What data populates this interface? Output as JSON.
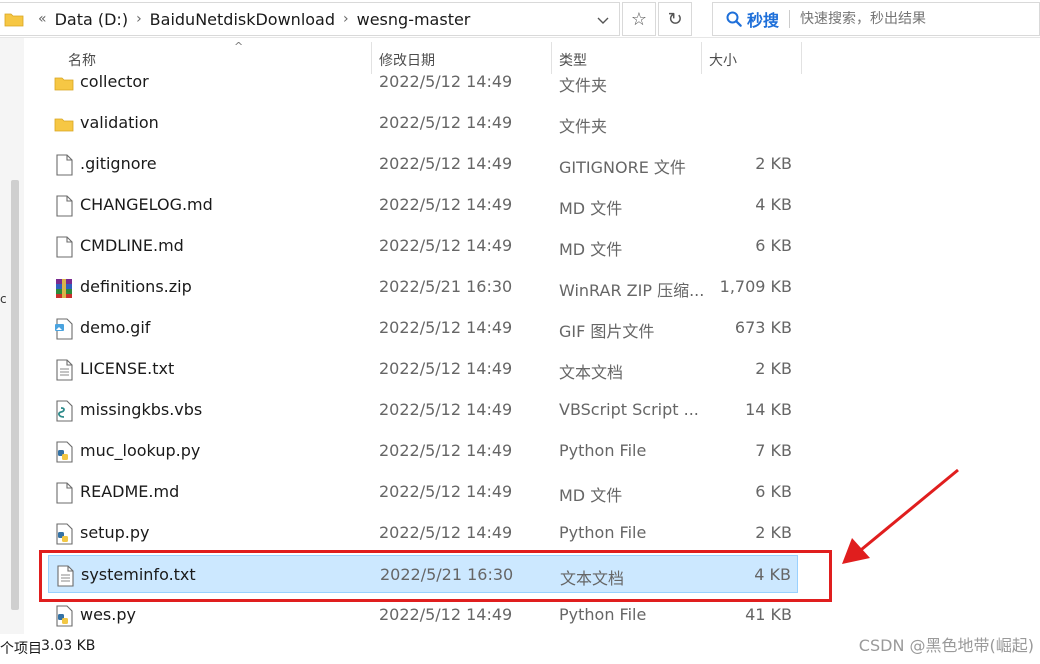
{
  "address": {
    "segments": [
      "Data (D:)",
      "BaiduNetdiskDownload",
      "wesng-master"
    ],
    "overflow": "«"
  },
  "toolbar": {
    "star_icon": "☆",
    "refresh_icon": "↻"
  },
  "search": {
    "brand": "秒搜",
    "placeholder": "快速搜索，秒出结果"
  },
  "side": {
    "fragment": "c"
  },
  "columns": {
    "name": "名称",
    "date": "修改日期",
    "type": "类型",
    "size": "大小",
    "sort_glyph": "^"
  },
  "files": [
    {
      "name": "collector",
      "date": "2022/5/12 14:49",
      "type": "文件夹",
      "size": "",
      "icon": "folder-icon"
    },
    {
      "name": "validation",
      "date": "2022/5/12 14:49",
      "type": "文件夹",
      "size": "",
      "icon": "folder-icon"
    },
    {
      "name": ".gitignore",
      "date": "2022/5/12 14:49",
      "type": "GITIGNORE 文件",
      "size": "2 KB",
      "icon": "blank-file-icon"
    },
    {
      "name": "CHANGELOG.md",
      "date": "2022/5/12 14:49",
      "type": "MD 文件",
      "size": "4 KB",
      "icon": "blank-file-icon"
    },
    {
      "name": "CMDLINE.md",
      "date": "2022/5/12 14:49",
      "type": "MD 文件",
      "size": "6 KB",
      "icon": "blank-file-icon"
    },
    {
      "name": "definitions.zip",
      "date": "2022/5/21 16:30",
      "type": "WinRAR ZIP 压缩...",
      "size": "1,709 KB",
      "icon": "winrar-icon"
    },
    {
      "name": "demo.gif",
      "date": "2022/5/12 14:49",
      "type": "GIF 图片文件",
      "size": "673 KB",
      "icon": "image-file-icon"
    },
    {
      "name": "LICENSE.txt",
      "date": "2022/5/12 14:49",
      "type": "文本文档",
      "size": "2 KB",
      "icon": "text-file-icon"
    },
    {
      "name": "missingkbs.vbs",
      "date": "2022/5/12 14:49",
      "type": "VBScript Script ...",
      "size": "14 KB",
      "icon": "vbscript-icon"
    },
    {
      "name": "muc_lookup.py",
      "date": "2022/5/12 14:49",
      "type": "Python File",
      "size": "7 KB",
      "icon": "python-file-icon"
    },
    {
      "name": "README.md",
      "date": "2022/5/12 14:49",
      "type": "MD 文件",
      "size": "6 KB",
      "icon": "blank-file-icon"
    },
    {
      "name": "setup.py",
      "date": "2022/5/12 14:49",
      "type": "Python File",
      "size": "2 KB",
      "icon": "python-file-icon"
    },
    {
      "name": "systeminfo.txt",
      "date": "2022/5/21 16:30",
      "type": "文本文档",
      "size": "4 KB",
      "icon": "text-file-icon",
      "selected": true
    },
    {
      "name": "wes.py",
      "date": "2022/5/12 14:49",
      "type": "Python File",
      "size": "41 KB",
      "icon": "python-file-icon"
    }
  ],
  "status": {
    "count": "个项目",
    "size": "3.03 KB"
  },
  "watermark": "CSDN @黑色地带(崛起)",
  "colors": {
    "selection": "#cce8ff",
    "annotation": "#e01e1e",
    "brand": "#1e6fd9"
  }
}
